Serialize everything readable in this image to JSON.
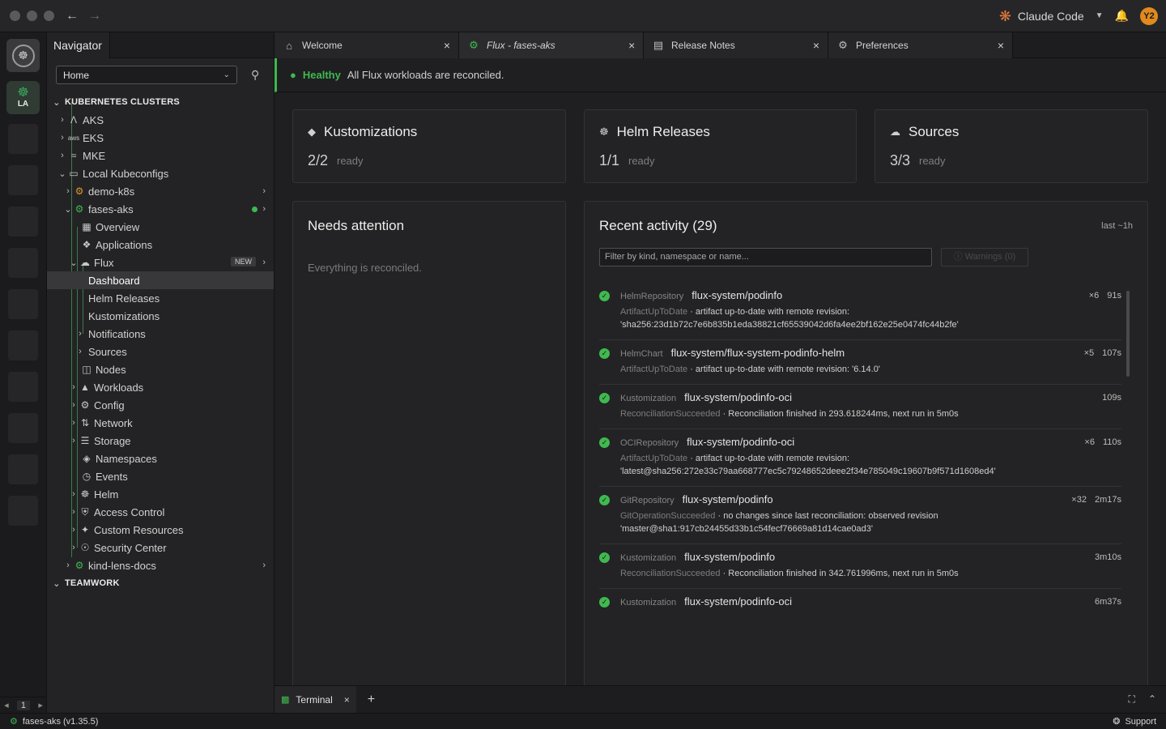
{
  "titlebar": {
    "assistant_label": "Claude Code",
    "avatar_initials": "Y2",
    "accent": "#e07a3c"
  },
  "hotbar": {
    "la_label": "LA",
    "page_number": "1"
  },
  "sidebar": {
    "tab_label": "Navigator",
    "select_value": "Home",
    "sections": {
      "clusters": "KUBERNETES CLUSTERS",
      "teamwork": "TEAMWORK"
    },
    "items": {
      "aks": "AKS",
      "eks": "EKS",
      "mke": "MKE",
      "local": "Local Kubeconfigs",
      "demo": "demo-k8s",
      "fases": "fases-aks",
      "overview": "Overview",
      "applications": "Applications",
      "flux": "Flux",
      "flux_badge": "NEW",
      "dashboard": "Dashboard",
      "helm_releases": "Helm Releases",
      "kustomizations": "Kustomizations",
      "notifications": "Notifications",
      "sources": "Sources",
      "nodes": "Nodes",
      "workloads": "Workloads",
      "config": "Config",
      "network": "Network",
      "storage": "Storage",
      "namespaces": "Namespaces",
      "events": "Events",
      "helm": "Helm",
      "access_control": "Access Control",
      "custom_resources": "Custom Resources",
      "security_center": "Security Center",
      "kind": "kind-lens-docs"
    }
  },
  "tabs": [
    {
      "label": "Welcome"
    },
    {
      "label": "Flux - fases-aks"
    },
    {
      "label": "Release Notes"
    },
    {
      "label": "Preferences"
    }
  ],
  "banner": {
    "status": "Healthy",
    "message": "All Flux workloads are reconciled.",
    "color": "#3fb950"
  },
  "stats": [
    {
      "title": "Kustomizations",
      "value": "2/2",
      "sub": "ready"
    },
    {
      "title": "Helm Releases",
      "value": "1/1",
      "sub": "ready"
    },
    {
      "title": "Sources",
      "value": "3/3",
      "sub": "ready"
    }
  ],
  "attention": {
    "title": "Needs attention",
    "message": "Everything is reconciled."
  },
  "activity": {
    "title": "Recent activity (29)",
    "window": "last ~1h",
    "filter_placeholder": "Filter by kind, namespace or name...",
    "warnings_label": "Warnings (0)",
    "events": [
      {
        "kind": "HelmRepository",
        "name": "flux-system/podinfo",
        "count": "×6",
        "age": "91s",
        "reason": "ArtifactUpToDate",
        "message": " · artifact up-to-date with remote revision:",
        "detail": "'sha256:23d1b72c7e6b835b1eda38821cf65539042d6fa4ee2bf162e25e0474fc44b2fe'"
      },
      {
        "kind": "HelmChart",
        "name": "flux-system/flux-system-podinfo-helm",
        "count": "×5",
        "age": "107s",
        "reason": "ArtifactUpToDate",
        "message": " · artifact up-to-date with remote revision: '6.14.0'",
        "detail": ""
      },
      {
        "kind": "Kustomization",
        "name": "flux-system/podinfo-oci",
        "count": "",
        "age": "109s",
        "reason": "ReconciliationSucceeded",
        "message": " · Reconciliation finished in 293.618244ms, next run in 5m0s",
        "detail": ""
      },
      {
        "kind": "OCIRepository",
        "name": "flux-system/podinfo-oci",
        "count": "×6",
        "age": "110s",
        "reason": "ArtifactUpToDate",
        "message": " · artifact up-to-date with remote revision:",
        "detail": "'latest@sha256:272e33c79aa668777ec5c79248652deee2f34e785049c19607b9f571d1608ed4'"
      },
      {
        "kind": "GitRepository",
        "name": "flux-system/podinfo",
        "count": "×32",
        "age": "2m17s",
        "reason": "GitOperationSucceeded",
        "message": " · no changes since last reconciliation: observed revision",
        "detail": "'master@sha1:917cb24455d33b1c54fecf76669a81d14cae0ad3'"
      },
      {
        "kind": "Kustomization",
        "name": "flux-system/podinfo",
        "count": "",
        "age": "3m10s",
        "reason": "ReconciliationSucceeded",
        "message": " · Reconciliation finished in 342.761996ms, next run in 5m0s",
        "detail": ""
      },
      {
        "kind": "Kustomization",
        "name": "flux-system/podinfo-oci",
        "count": "",
        "age": "6m37s",
        "reason": "",
        "message": "",
        "detail": ""
      }
    ]
  },
  "terminal": {
    "tab_label": "Terminal"
  },
  "statusbar": {
    "cluster": "fases-aks (v1.35.5)",
    "support": "Support"
  }
}
